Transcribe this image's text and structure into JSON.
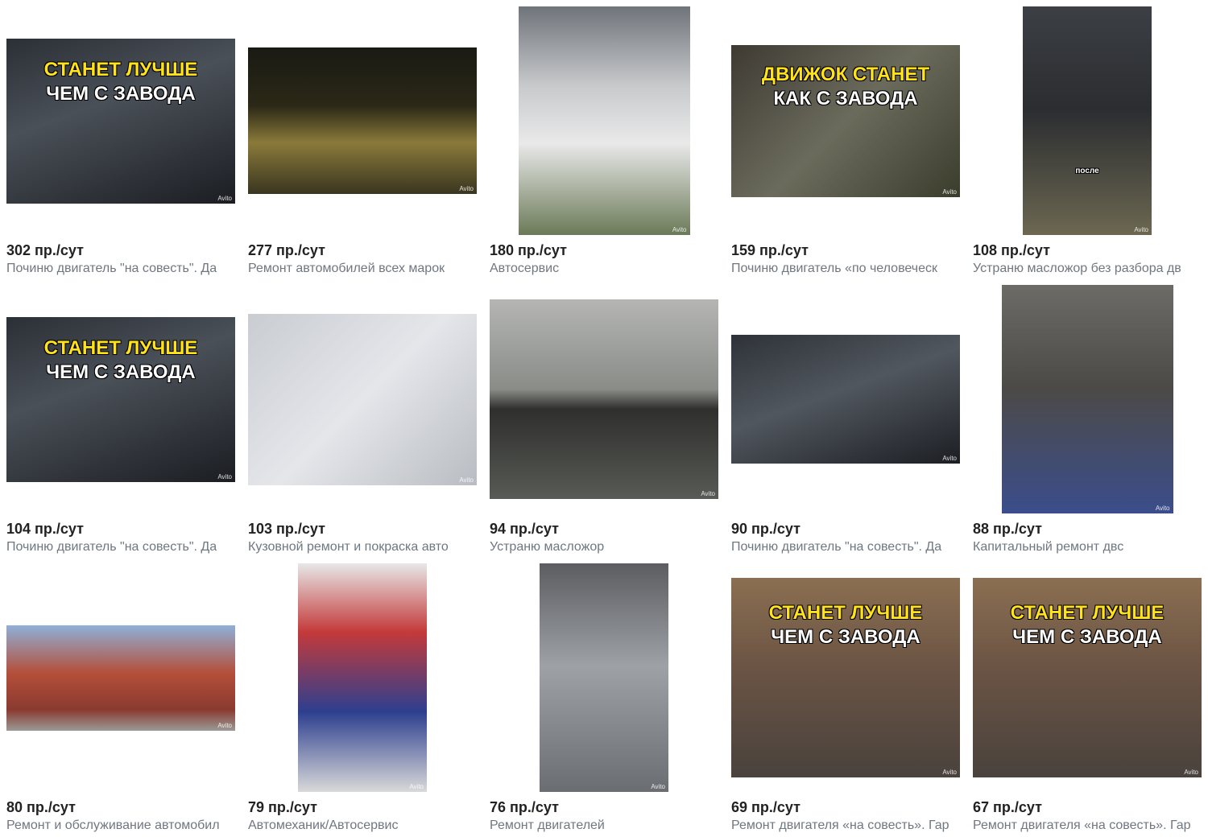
{
  "watermark": "Avito",
  "items": [
    {
      "views": "302 пр./сут",
      "title": "Починю двигатель \"на совесть\". Да",
      "caption1": "СТАНЕТ ЛУЧШЕ",
      "caption2": "ЧЕМ С ЗАВОДА",
      "image": "engine-bay"
    },
    {
      "views": "277 пр./сут",
      "title": "Ремонт автомобилей всех марок",
      "caption1": "",
      "caption2": "",
      "image": "gold-car"
    },
    {
      "views": "180 пр./сут",
      "title": "Автосервис",
      "caption1": "",
      "caption2": "",
      "image": "garage"
    },
    {
      "views": "159 пр./сут",
      "title": "Починю двигатель «по человеческ",
      "caption1": "ДВИЖОК СТАНЕТ",
      "caption2": "КАК С ЗАВОДА",
      "image": "mechanic-portrait"
    },
    {
      "views": "108 пр./сут",
      "title": "Устраню масложор без разбора дв",
      "caption1": "",
      "caption2": "после",
      "image": "young-man"
    },
    {
      "views": "104 пр./сут",
      "title": "Починю двигатель \"на совесть\". Да",
      "caption1": "СТАНЕТ ЛУЧШЕ",
      "caption2": "ЧЕМ С ЗАВОДА",
      "image": "engine-bay"
    },
    {
      "views": "103 пр./сут",
      "title": "Кузовной ремонт и покраска авто",
      "caption1": "",
      "caption2": "",
      "image": "car-fender"
    },
    {
      "views": "94 пр./сут",
      "title": "Устраню масложор",
      "caption1": "",
      "caption2": "",
      "image": "valves"
    },
    {
      "views": "90 пр./сут",
      "title": "Починю двигатель \"на совесть\". Да",
      "caption1": "",
      "caption2": "",
      "image": "engine-bay-plain"
    },
    {
      "views": "88 пр./сут",
      "title": "Капитальный ремонт двс",
      "caption1": "",
      "caption2": "",
      "image": "engine-block"
    },
    {
      "views": "80 пр./сут",
      "title": "Ремонт и обслуживание автомобил",
      "caption1": "",
      "caption2": "",
      "image": "building"
    },
    {
      "views": "79 пр./сут",
      "title": "Автомеханик/Автосервис",
      "caption1": "",
      "caption2": "",
      "image": "blue-car"
    },
    {
      "views": "76 пр./сут",
      "title": "Ремонт двигателей",
      "caption1": "",
      "caption2": "",
      "image": "pistons"
    },
    {
      "views": "69 пр./сут",
      "title": "Ремонт двигателя «на совесть». Гар",
      "caption1": "СТАНЕТ ЛУЧШЕ",
      "caption2": "ЧЕМ С ЗАВОДА",
      "image": "mechanic-parts"
    },
    {
      "views": "67 пр./сут",
      "title": "Ремонт двигателя «на совесть». Гар",
      "caption1": "СТАНЕТ ЛУЧШЕ",
      "caption2": "ЧЕМ С ЗАВОДА",
      "image": "mechanic-parts"
    }
  ]
}
